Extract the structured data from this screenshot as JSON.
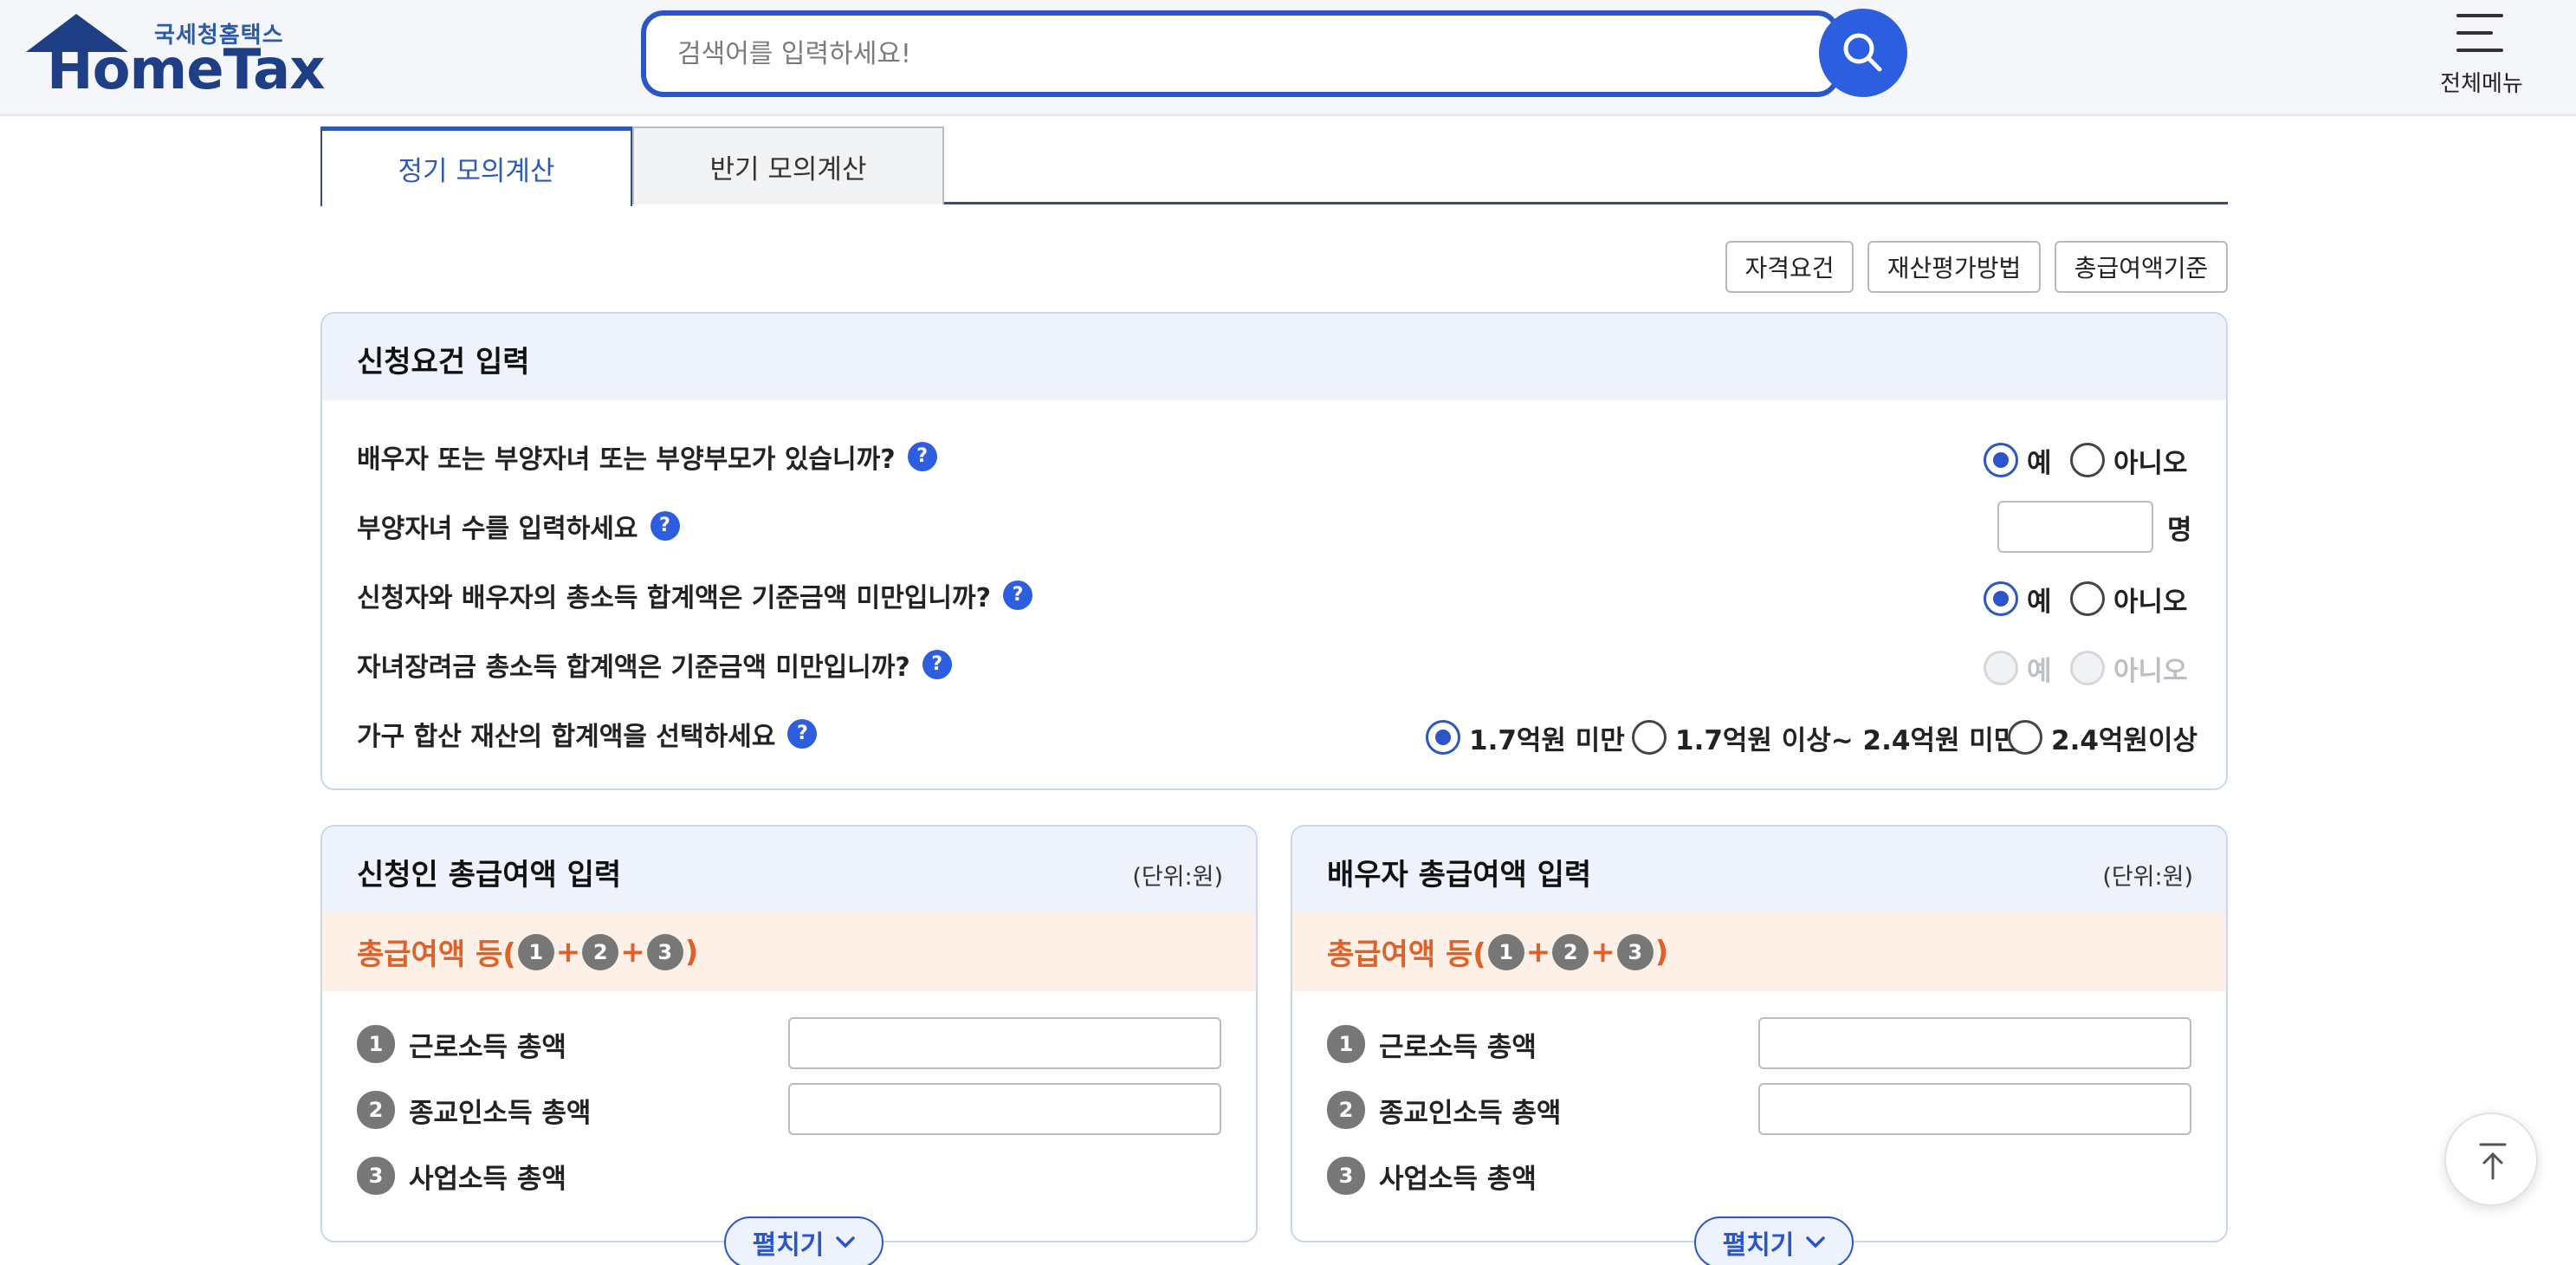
{
  "header": {
    "logo_sub": "국세청홈택스",
    "logo_main": "HomeTax",
    "search_placeholder": "검색어를 입력하세요!",
    "menu_label": "전체메뉴"
  },
  "tabs": [
    {
      "label": "정기 모의계산",
      "active": true
    },
    {
      "label": "반기 모의계산",
      "active": false
    }
  ],
  "info_buttons": [
    "자격요건",
    "재산평가방법",
    "총급여액기준"
  ],
  "requirements": {
    "title": "신청요건 입력",
    "q1": "배우자 또는 부양자녀 또는 부양부모가 있습니까?",
    "q2": "부양자녀 수를 입력하세요",
    "q3": "신청자와 배우자의 총소득 합계액은 기준금액 미만입니까?",
    "q4": "자녀장려금 총소득 합계액은 기준금액 미만입니까?",
    "q5": "가구 합산 재산의 합계액을 선택하세요",
    "yes": "예",
    "no": "아니오",
    "child_unit": "명",
    "child_count": "",
    "q1_selected": "예",
    "q3_selected": "예",
    "q4_disabled": true,
    "assets": [
      "1.7억원 미만",
      "1.7억원 이상~ 2.4억원 미만",
      "2.4억원이상"
    ],
    "assets_selected": "1.7억원 미만"
  },
  "applicant": {
    "title": "신청인 총급여액 입력",
    "unit": "(단위:원)",
    "sum_prefix": "총급여액 등(",
    "sum_suffix": ")",
    "items": [
      "근로소득 총액",
      "종교인소득 총액",
      "사업소득 총액"
    ],
    "expand": "펼치기"
  },
  "spouse": {
    "title": "배우자 총급여액 입력",
    "unit": "(단위:원)",
    "sum_prefix": "총급여액 등(",
    "sum_suffix": ")",
    "items": [
      "근로소득 총액",
      "종교인소득 총액",
      "사업소득 총액"
    ],
    "expand": "펼치기"
  },
  "circle_nums": [
    "1",
    "2",
    "3"
  ],
  "plus": "+",
  "help_mark": "?",
  "colors": {
    "primary": "#2b55c8",
    "header_bg": "#f5f6f9",
    "panel_head": "#edf2fb",
    "sum_bg": "#fdf0e6",
    "sum_text": "#e0602a"
  }
}
